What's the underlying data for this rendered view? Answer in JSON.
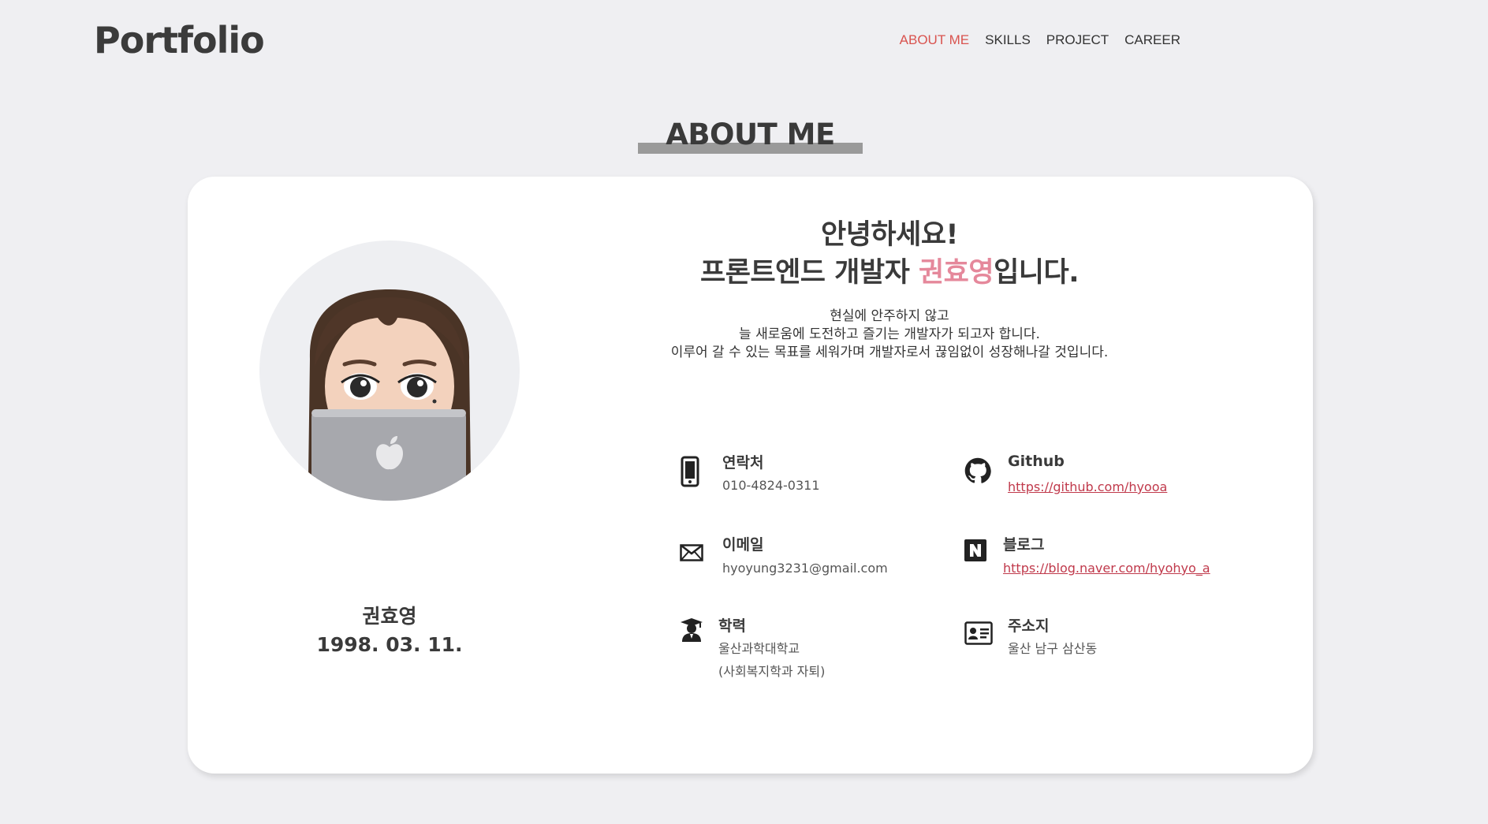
{
  "header": {
    "logo": "Portfolio",
    "nav": [
      "ABOUT ME",
      "SKILLS",
      "PROJECT",
      "CAREER"
    ],
    "active_nav": "ABOUT ME",
    "accent_color": "#d9534f"
  },
  "section": {
    "title": "ABOUT ME"
  },
  "profile": {
    "name": "권효영",
    "birth": "1998. 03. 11.",
    "avatar_icon": "memoji-laptop-avatar"
  },
  "intro": {
    "greeting": "안녕하세요!",
    "line_prefix": "프론트엔드 개발자 ",
    "highlight_name": "권효영",
    "line_suffix": "입니다.",
    "highlight_color": "#e5889b",
    "desc": [
      "현실에 안주하지 않고",
      "늘 새로움에 도전하고 즐기는 개발자가 되고자 합니다.",
      "이루어 갈 수 있는 목표를 세워가며 개발자로서 끊임없이 성장해나갈 것입니다."
    ]
  },
  "info": {
    "contact": {
      "label": "연락처",
      "value": "010-4824-0311",
      "icon": "phone-icon"
    },
    "github": {
      "label": "Github",
      "value": "https://github.com/hyooa",
      "icon": "github-icon"
    },
    "email": {
      "label": "이메일",
      "value": "hyoyung3231@gmail.com",
      "icon": "mail-icon"
    },
    "blog": {
      "label": "블로그",
      "value": "https://blog.naver.com/hyohyo_a",
      "icon": "naver-icon"
    },
    "education": {
      "label": "학력",
      "value": "울산과학대학교",
      "value2": "(사회복지학과 자퇴)",
      "icon": "graduate-icon"
    },
    "address": {
      "label": "주소지",
      "value": "울산 남구 삼산동",
      "icon": "id-card-icon"
    }
  }
}
